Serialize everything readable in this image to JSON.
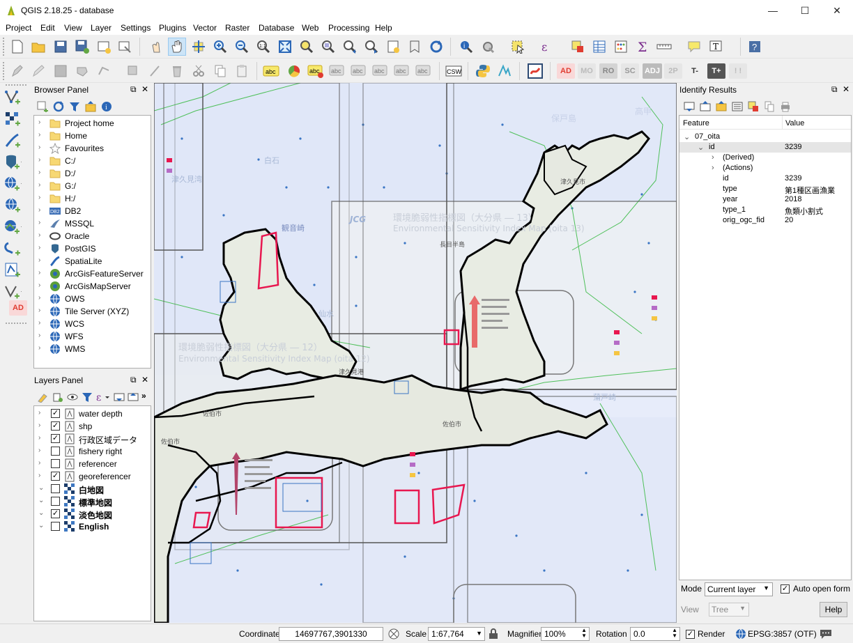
{
  "window": {
    "title": "QGIS 2.18.25 - database",
    "minimize": "—",
    "maximize": "☐",
    "close": "✕"
  },
  "menu": [
    "Project",
    "Edit",
    "View",
    "Layer",
    "Settings",
    "Plugins",
    "Vector",
    "Raster",
    "Database",
    "Web",
    "Processing",
    "Help"
  ],
  "label_toolbar": {
    "ad": "AD",
    "mo": "MO",
    "ro": "RO",
    "sc": "SC",
    "adj": "ADJ",
    "two_p": "2P",
    "t_minus": "T-",
    "t_plus": "T+",
    "bang": "! !",
    "csw": "CSW",
    "abc": "abc"
  },
  "left_tools": {
    "ad_label": "AD"
  },
  "browser": {
    "title": "Browser Panel",
    "items": [
      {
        "label": "Project home",
        "icon": "folder-icon"
      },
      {
        "label": "Home",
        "icon": "folder-icon"
      },
      {
        "label": "Favourites",
        "icon": "star-icon"
      },
      {
        "label": "C:/",
        "icon": "folder-icon"
      },
      {
        "label": "D:/",
        "icon": "folder-icon"
      },
      {
        "label": "G:/",
        "icon": "folder-icon"
      },
      {
        "label": "H:/",
        "icon": "folder-icon"
      },
      {
        "label": "DB2",
        "icon": "db2-icon"
      },
      {
        "label": "MSSQL",
        "icon": "mssql-icon"
      },
      {
        "label": "Oracle",
        "icon": "oracle-icon"
      },
      {
        "label": "PostGIS",
        "icon": "postgis-icon"
      },
      {
        "label": "SpatiaLite",
        "icon": "spatialite-icon"
      },
      {
        "label": "ArcGisFeatureServer",
        "icon": "arcgis-icon"
      },
      {
        "label": "ArcGisMapServer",
        "icon": "arcgis-icon"
      },
      {
        "label": "OWS",
        "icon": "globe-icon"
      },
      {
        "label": "Tile Server (XYZ)",
        "icon": "globe-icon"
      },
      {
        "label": "WCS",
        "icon": "globe-icon"
      },
      {
        "label": "WFS",
        "icon": "globe-icon"
      },
      {
        "label": "WMS",
        "icon": "globe-icon"
      }
    ]
  },
  "layers": {
    "title": "Layers Panel",
    "items": [
      {
        "label": "water depth",
        "checked": true,
        "bold": false,
        "expanded": false
      },
      {
        "label": "shp",
        "checked": true,
        "bold": false,
        "expanded": false
      },
      {
        "label": "行政区域データ",
        "checked": true,
        "bold": false,
        "expanded": false
      },
      {
        "label": "fishery right",
        "checked": false,
        "bold": false,
        "expanded": false
      },
      {
        "label": "referencer",
        "checked": false,
        "bold": false,
        "expanded": false
      },
      {
        "label": "georeferencer",
        "checked": true,
        "bold": false,
        "expanded": false
      },
      {
        "label": "白地図",
        "checked": false,
        "bold": true,
        "expanded": true
      },
      {
        "label": "標準地図",
        "checked": false,
        "bold": true,
        "expanded": true
      },
      {
        "label": "淡色地図",
        "checked": true,
        "bold": true,
        "expanded": true
      },
      {
        "label": "English",
        "checked": false,
        "bold": true,
        "expanded": true
      }
    ]
  },
  "identify": {
    "title": "Identify Results",
    "col_feature": "Feature",
    "col_value": "Value",
    "rows": [
      {
        "indent": 0,
        "arrow": "⌄",
        "feature": "07_oita",
        "value": "",
        "selected": false
      },
      {
        "indent": 1,
        "arrow": "⌄",
        "feature": "id",
        "value": "3239",
        "selected": true
      },
      {
        "indent": 2,
        "arrow": "›",
        "feature": "(Derived)",
        "value": "",
        "selected": false
      },
      {
        "indent": 2,
        "arrow": "›",
        "feature": "(Actions)",
        "value": "",
        "selected": false
      },
      {
        "indent": 2,
        "arrow": "",
        "feature": "id",
        "value": "3239",
        "selected": false
      },
      {
        "indent": 2,
        "arrow": "",
        "feature": "type",
        "value": "第1種区画漁業",
        "selected": false
      },
      {
        "indent": 2,
        "arrow": "",
        "feature": "year",
        "value": "2018",
        "selected": false
      },
      {
        "indent": 2,
        "arrow": "",
        "feature": "type_1",
        "value": "魚類小割式",
        "selected": false
      },
      {
        "indent": 2,
        "arrow": "",
        "feature": "orig_ogc_fid",
        "value": "20",
        "selected": false
      }
    ],
    "mode_label": "Mode",
    "mode_value": "Current layer",
    "auto_open_label": "Auto open form",
    "view_label": "View",
    "view_value": "Tree",
    "help_label": "Help"
  },
  "map": {
    "labels": {
      "l1": "白石",
      "l2": "津久見湾",
      "l3": "観音崎",
      "l4": "保戸島",
      "l5": "高甲",
      "l6": "津久見市",
      "l7": "佐伯市",
      "l8": "佐伯市",
      "l9": "佐伯市",
      "l10": "蒲戸崎",
      "l11": "環境脆弱性指標図（大分県 ― 13）",
      "l12": "Environmental Sensitivity Index Map (oita 13)",
      "l13": "環境脆弱性指標図（大分県 ― 12）",
      "l14": "Environmental Sensitivity Index Map (oita 12)",
      "l15": "JCG",
      "l16": "仙水",
      "l17": "津久見港",
      "l18": "長目半島"
    }
  },
  "status": {
    "coordinate_label": "Coordinate",
    "coordinate_value": "14697767,3901330",
    "scale_label": "Scale",
    "scale_value": "1:67,764",
    "magnifier_label": "Magnifier",
    "magnifier_value": "100%",
    "rotation_label": "Rotation",
    "rotation_value": "0.0",
    "render_label": "Render",
    "epsg_label": "EPSG:3857 (OTF)"
  }
}
